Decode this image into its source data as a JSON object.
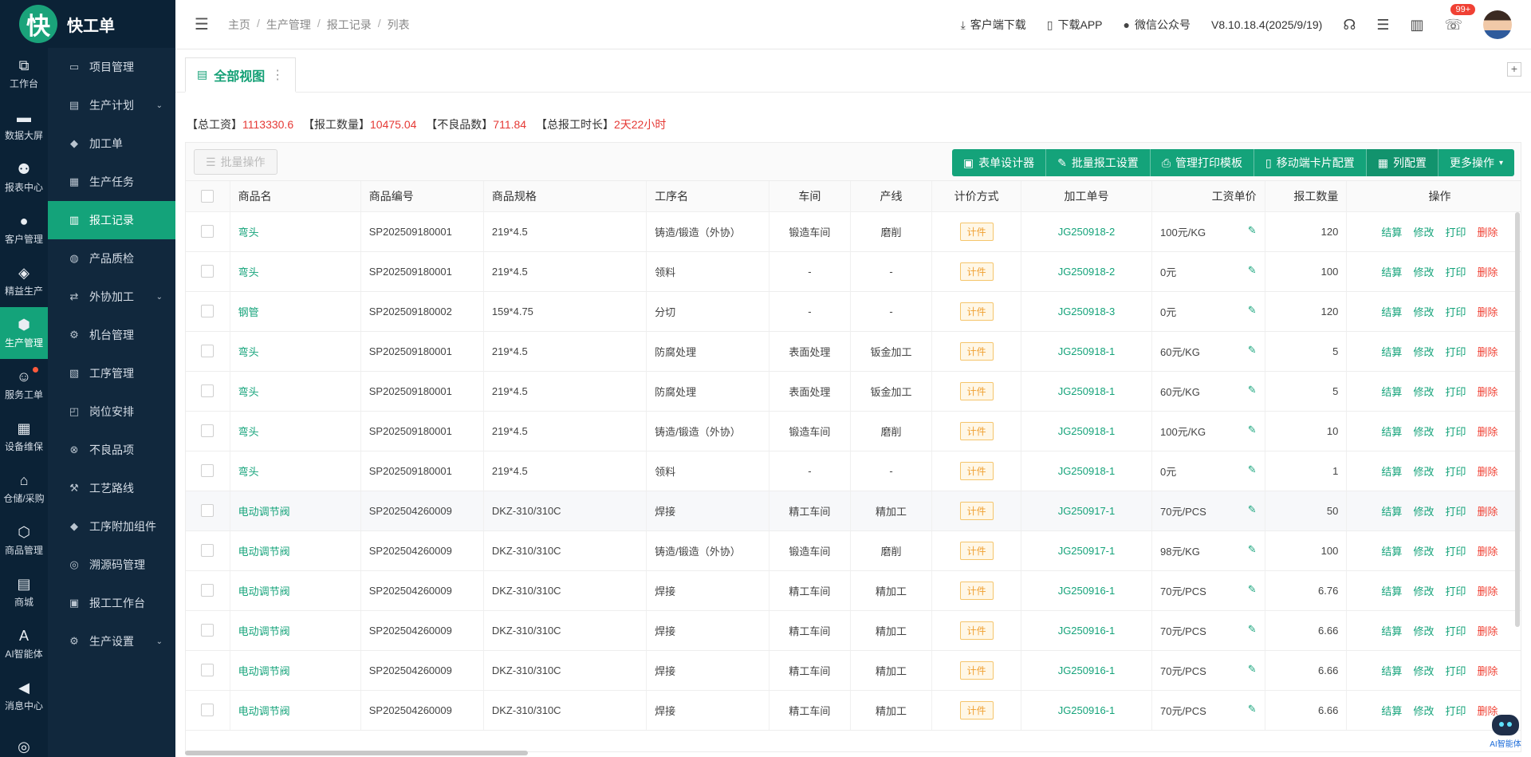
{
  "app": {
    "logo_char": "快",
    "name": "快工单"
  },
  "rail": [
    {
      "label": "工作台",
      "icon": "⧉"
    },
    {
      "label": "数据大屏",
      "icon": "▬"
    },
    {
      "label": "报表中心",
      "icon": "⚉"
    },
    {
      "label": "客户管理",
      "icon": "●"
    },
    {
      "label": "精益生产",
      "icon": "◈"
    },
    {
      "label": "生产管理",
      "icon": "⬢",
      "active": true
    },
    {
      "label": "服务工单",
      "icon": "☺",
      "dot": true
    },
    {
      "label": "设备维保",
      "icon": "▦"
    },
    {
      "label": "仓储/采购",
      "icon": "⌂"
    },
    {
      "label": "商品管理",
      "icon": "⬡"
    },
    {
      "label": "商城",
      "icon": "▤"
    },
    {
      "label": "AI智能体",
      "icon": "A"
    },
    {
      "label": "消息中心",
      "icon": "◀"
    },
    {
      "label": "",
      "icon": "◎"
    }
  ],
  "submenu": [
    {
      "label": "项目管理",
      "icon": "▭"
    },
    {
      "label": "生产计划",
      "icon": "▤",
      "chevron": true
    },
    {
      "label": "加工单",
      "icon": "◆"
    },
    {
      "label": "生产任务",
      "icon": "▦"
    },
    {
      "label": "报工记录",
      "icon": "▥",
      "active": true
    },
    {
      "label": "产品质检",
      "icon": "◍"
    },
    {
      "label": "外协加工",
      "icon": "⇄",
      "chevron": true
    },
    {
      "label": "机台管理",
      "icon": "⚙"
    },
    {
      "label": "工序管理",
      "icon": "▧"
    },
    {
      "label": "岗位安排",
      "icon": "◰"
    },
    {
      "label": "不良品项",
      "icon": "⊗"
    },
    {
      "label": "工艺路线",
      "icon": "⚒"
    },
    {
      "label": "工序附加组件",
      "icon": "◆"
    },
    {
      "label": "溯源码管理",
      "icon": "◎"
    },
    {
      "label": "报工工作台",
      "icon": "▣"
    },
    {
      "label": "生产设置",
      "icon": "⚙",
      "chevron": true
    }
  ],
  "breadcrumb": [
    "主页",
    "生产管理",
    "报工记录",
    "列表"
  ],
  "header": {
    "client_download": "客户端下载",
    "app_download": "下载APP",
    "wechat": "微信公众号",
    "version": "V8.10.18.4(2025/9/19)",
    "badge": "99+"
  },
  "tab": {
    "label": "全部视图",
    "more": "⋮",
    "add": "+"
  },
  "summary": {
    "total_wage_label": "【总工资】",
    "total_wage": "1113330.6",
    "qty_label": "【报工数量】",
    "qty": "10475.04",
    "defect_label": "【不良品数】",
    "defect": "711.84",
    "duration_label": "【总报工时长】",
    "duration": "2天22小时"
  },
  "toolbar": {
    "batch": "批量操作",
    "actions": [
      "表单设计器",
      "批量报工设置",
      "管理打印模板",
      "移动端卡片配置",
      "列配置",
      "更多操作"
    ]
  },
  "table": {
    "headers": [
      "商品名",
      "商品编号",
      "商品规格",
      "工序名",
      "车间",
      "产线",
      "计价方式",
      "加工单号",
      "工资单价",
      "报工数量",
      "",
      "操作"
    ],
    "op_labels": [
      "结算",
      "修改",
      "打印",
      "删除"
    ],
    "rows": [
      [
        "弯头",
        "SP202509180001",
        "219*4.5",
        "铸造/锻造（外协）",
        "锻造车间",
        "磨削",
        "计件",
        "JG250918-2",
        "100元/KG",
        "120"
      ],
      [
        "弯头",
        "SP202509180001",
        "219*4.5",
        "领料",
        "-",
        "-",
        "计件",
        "JG250918-2",
        "0元",
        "100"
      ],
      [
        "钢管",
        "SP202509180002",
        "159*4.75",
        "分切",
        "-",
        "-",
        "计件",
        "JG250918-3",
        "0元",
        "120"
      ],
      [
        "弯头",
        "SP202509180001",
        "219*4.5",
        "防腐处理",
        "表面处理",
        "钣金加工",
        "计件",
        "JG250918-1",
        "60元/KG",
        "5"
      ],
      [
        "弯头",
        "SP202509180001",
        "219*4.5",
        "防腐处理",
        "表面处理",
        "钣金加工",
        "计件",
        "JG250918-1",
        "60元/KG",
        "5"
      ],
      [
        "弯头",
        "SP202509180001",
        "219*4.5",
        "铸造/锻造（外协）",
        "锻造车间",
        "磨削",
        "计件",
        "JG250918-1",
        "100元/KG",
        "10"
      ],
      [
        "弯头",
        "SP202509180001",
        "219*4.5",
        "领料",
        "-",
        "-",
        "计件",
        "JG250918-1",
        "0元",
        "1"
      ],
      [
        "电动调节阀",
        "SP202504260009",
        "DKZ-310/310C",
        "焊接",
        "精工车间",
        "精加工",
        "计件",
        "JG250917-1",
        "70元/PCS",
        "50"
      ],
      [
        "电动调节阀",
        "SP202504260009",
        "DKZ-310/310C",
        "铸造/锻造（外协）",
        "锻造车间",
        "磨削",
        "计件",
        "JG250917-1",
        "98元/KG",
        "100"
      ],
      [
        "电动调节阀",
        "SP202504260009",
        "DKZ-310/310C",
        "焊接",
        "精工车间",
        "精加工",
        "计件",
        "JG250916-1",
        "70元/PCS",
        "6.76"
      ],
      [
        "电动调节阀",
        "SP202504260009",
        "DKZ-310/310C",
        "焊接",
        "精工车间",
        "精加工",
        "计件",
        "JG250916-1",
        "70元/PCS",
        "6.66"
      ],
      [
        "电动调节阀",
        "SP202504260009",
        "DKZ-310/310C",
        "焊接",
        "精工车间",
        "精加工",
        "计件",
        "JG250916-1",
        "70元/PCS",
        "6.66"
      ],
      [
        "电动调节阀",
        "SP202504260009",
        "DKZ-310/310C",
        "焊接",
        "精工车间",
        "精加工",
        "计件",
        "JG250916-1",
        "70元/PCS",
        "6.66"
      ]
    ]
  },
  "ai_widget": "AI智能体",
  "colors": {
    "primary": "#14a37a",
    "sidebar": "#0b2236",
    "danger": "#f04134"
  }
}
